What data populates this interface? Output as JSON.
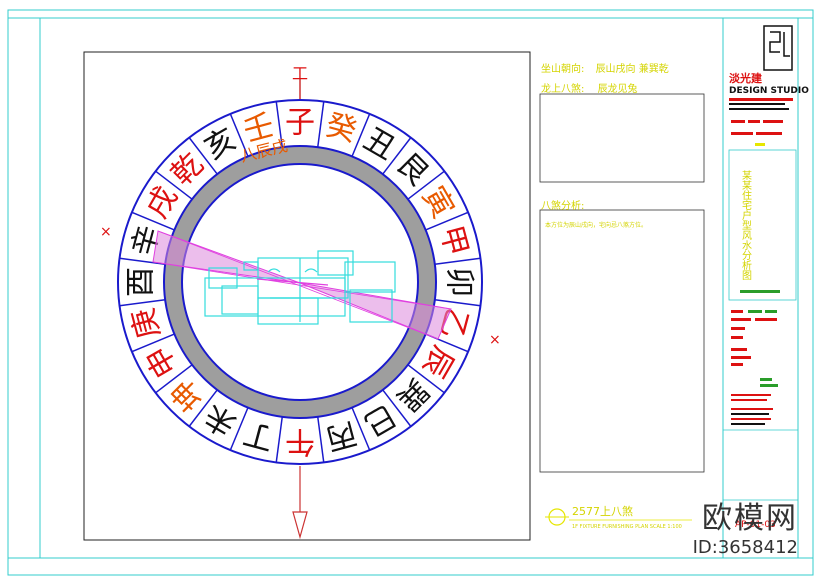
{
  "colors": {
    "frame_cyan": "#33cccc",
    "ring_blue": "#1a1acc",
    "ring_gray": "#9e9e9e",
    "text_orange": "#e85a00",
    "text_red": "#dd1111",
    "text_black": "#111111",
    "text_green": "#2a9d2a",
    "text_yellow": "#d4d400",
    "wedge_pink": "#dd88dd",
    "magenta": "#e040e0",
    "floor_cyan": "#33dddd"
  },
  "compass": {
    "north_label": "工",
    "outer_chars": [
      {
        "char": "癸",
        "color": "orange"
      },
      {
        "char": "丑",
        "color": "black"
      },
      {
        "char": "艮",
        "color": "black"
      },
      {
        "char": "寅",
        "color": "orange"
      },
      {
        "char": "甲",
        "color": "red"
      },
      {
        "char": "卯",
        "color": "black"
      },
      {
        "char": "乙",
        "color": "red"
      },
      {
        "char": "辰",
        "color": "red"
      },
      {
        "char": "巽",
        "color": "black"
      },
      {
        "char": "巳",
        "color": "black"
      },
      {
        "char": "丙",
        "color": "black"
      },
      {
        "char": "午",
        "color": "red"
      },
      {
        "char": "丁",
        "color": "black"
      },
      {
        "char": "未",
        "color": "black"
      },
      {
        "char": "坤",
        "color": "orange"
      },
      {
        "char": "申",
        "color": "red"
      },
      {
        "char": "庚",
        "color": "red"
      },
      {
        "char": "酉",
        "color": "black"
      },
      {
        "char": "辛",
        "color": "black"
      },
      {
        "char": "戌",
        "color": "red"
      },
      {
        "char": "乾",
        "color": "red"
      },
      {
        "char": "亥",
        "color": "black"
      },
      {
        "char": "壬",
        "color": "orange"
      },
      {
        "char": "子",
        "color": "red"
      }
    ],
    "inner_label": "八辰戌",
    "cross_marks": [
      "×",
      "×"
    ]
  },
  "info": {
    "sitting_label": "坐山朝向:",
    "sitting_value": "辰山戌向  兼巽乾",
    "dragon_label": "龙上八煞:",
    "dragon_value": "辰龙见兔",
    "analysis_label": "八煞分析:",
    "note_text": "本方位为辰山戌向，宅向忌八煞方位。"
  },
  "plan_label": {
    "title": "2577上八煞",
    "subtitle": "1F FIXTURE FURNISHING PLAN    SCALE 1:100"
  },
  "titleblock": {
    "company_name": "淡光建",
    "studio": "DESIGN STUDIO",
    "project_vertical": "某某住宅户型风水分析图",
    "drawing_no": "AP-01-03"
  },
  "watermark": {
    "logo": "欧模网",
    "id": "ID:3658412"
  }
}
